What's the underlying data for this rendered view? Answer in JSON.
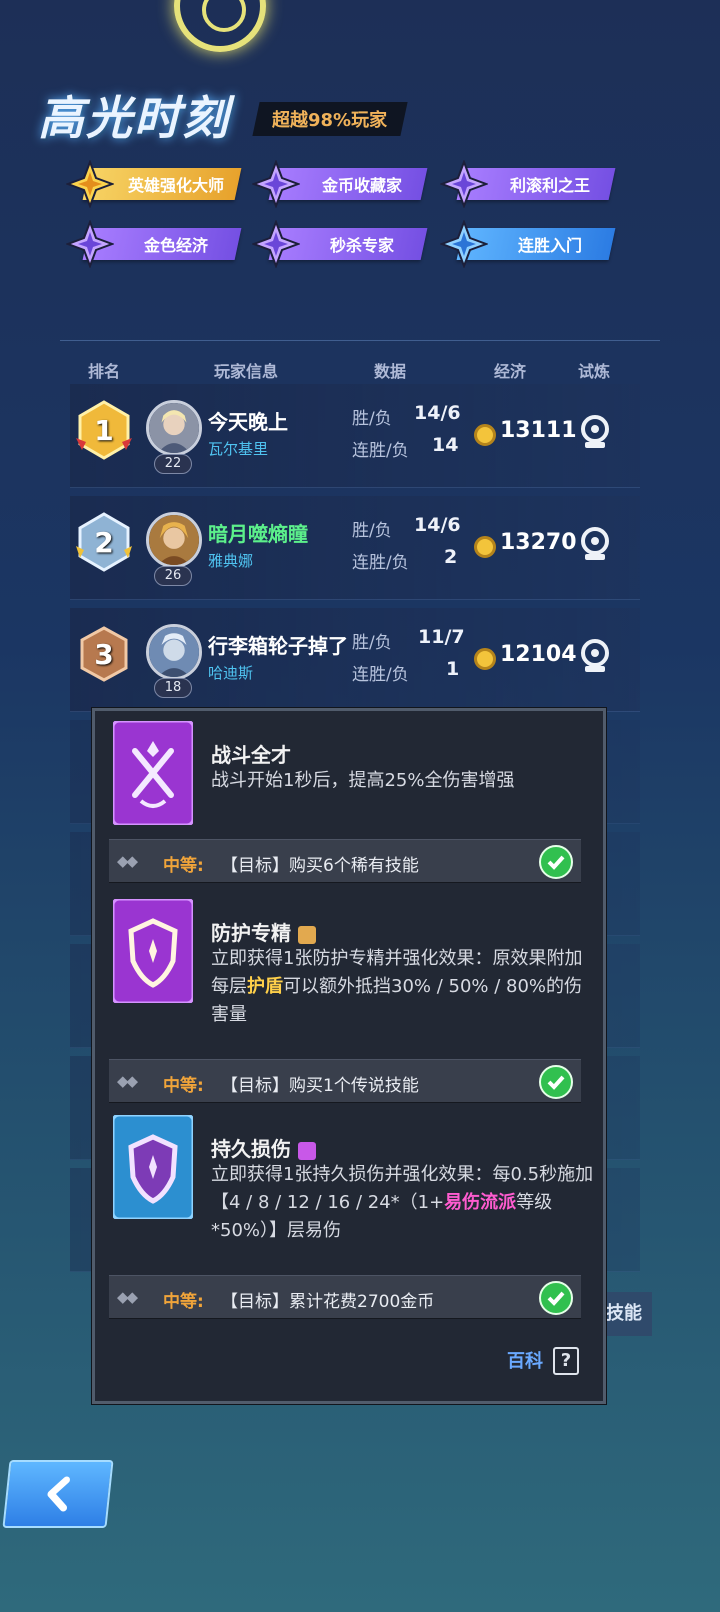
{
  "header": {
    "title": "高光时刻",
    "badge": "超越98%玩家"
  },
  "achievements": [
    {
      "label": "英雄强化大师",
      "tier": "gold"
    },
    {
      "label": "金币收藏家",
      "tier": "purple"
    },
    {
      "label": "利滚利之王",
      "tier": "purple"
    },
    {
      "label": "金色经济",
      "tier": "purple"
    },
    {
      "label": "秒杀专家",
      "tier": "purple"
    },
    {
      "label": "连胜入门",
      "tier": "blue"
    }
  ],
  "columns": {
    "rank": "排名",
    "player": "玩家信息",
    "data": "数据",
    "economy": "经济",
    "trial": "试炼"
  },
  "stat_labels": {
    "wl": "胜/负",
    "streak": "连胜/负"
  },
  "players": [
    {
      "rank": "1",
      "name": "今天晚上",
      "hero": "瓦尔基里",
      "level": "22",
      "wl": "14/6",
      "streak": "14",
      "gold": "13111"
    },
    {
      "rank": "2",
      "name": "暗月噬熵瞳",
      "hero": "雅典娜",
      "level": "26",
      "wl": "14/6",
      "streak": "2",
      "gold": "13270"
    },
    {
      "rank": "3",
      "name": "行李箱轮子掉了",
      "hero": "哈迪斯",
      "level": "18",
      "wl": "11/7",
      "streak": "1",
      "gold": "12104"
    }
  ],
  "popup": {
    "skills": [
      {
        "title": "战斗全才",
        "desc": "战斗开始1秒后，提高25%全伤害增强",
        "goal_level": "中等:",
        "goal_text": "【目标】购买6个稀有技能"
      },
      {
        "title": "防护专精",
        "desc_a": "立即获得1张防护专精并强化效果：原效果附加每层",
        "desc_hl": "护盾",
        "desc_b": "可以额外抵挡30% / 50% / 80%的伤害量",
        "goal_level": "中等:",
        "goal_text": "【目标】购买1个传说技能"
      },
      {
        "title": "持久损伤",
        "desc_a": "立即获得1张持久损伤并强化效果：每0.5秒施加【4 / 8 / 12 / 16 / 24*（1+",
        "desc_hl": "易伤流派",
        "desc_b": "等级*50%）】层易伤",
        "goal_level": "中等:",
        "goal_text": "【目标】累计花费2700金币"
      }
    ],
    "wiki_label": "百科",
    "wiki_icon_glyph": "?"
  },
  "background_button_text": "技能",
  "colors": {
    "gold": "#f3c43b",
    "accent_blue": "#4fc3f0",
    "green_name": "#5cf08b",
    "check": "#31c04f"
  }
}
